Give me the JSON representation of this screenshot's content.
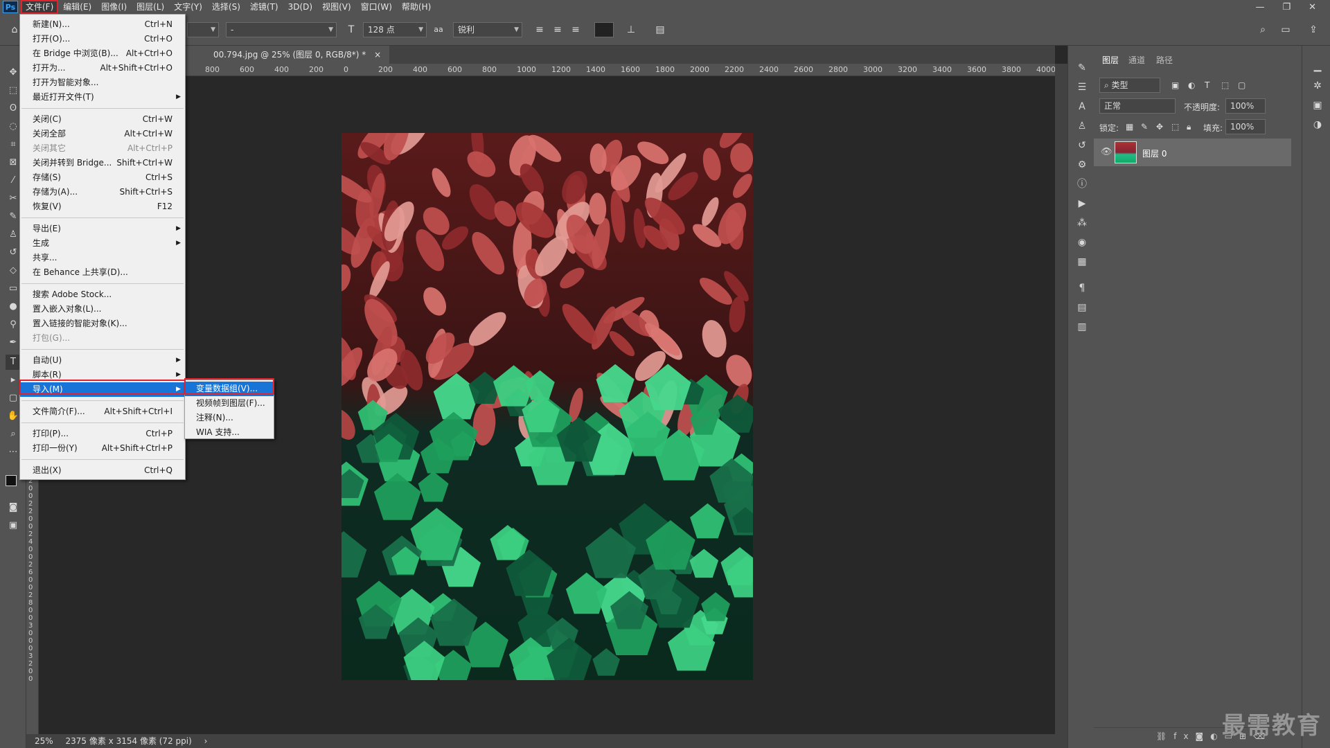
{
  "menubar": {
    "logo": "Ps",
    "items": [
      "文件(F)",
      "编辑(E)",
      "图像(I)",
      "图层(L)",
      "文字(Y)",
      "选择(S)",
      "滤镜(T)",
      "3D(D)",
      "视图(V)",
      "窗口(W)",
      "帮助(H)"
    ],
    "window_buttons": [
      "—",
      "❐",
      "✕"
    ]
  },
  "options": {
    "font_style": "-",
    "font_size": "128 点",
    "aa_icon": "aa",
    "antialias": "锐利"
  },
  "document": {
    "tab_title": "00.794.jpg @ 25% (图层 0, RGB/8*) *",
    "close": "×"
  },
  "ruler_h": [
    "800",
    "600",
    "400",
    "200",
    "0",
    "200",
    "400",
    "600",
    "800",
    "1000",
    "1200",
    "1400",
    "1600",
    "1800",
    "2000",
    "2200",
    "2400",
    "2600",
    "2800",
    "3000",
    "3200",
    "3400",
    "3600",
    "3800",
    "4000"
  ],
  "ruler_v": [
    "2",
    "0",
    "0",
    "2",
    "2",
    "0",
    "0",
    "2",
    "4",
    "0",
    "0",
    "2",
    "6",
    "0",
    "0",
    "2",
    "8",
    "0",
    "0",
    "3",
    "0",
    "0",
    "0",
    "3",
    "2",
    "0",
    "0"
  ],
  "status": {
    "zoom": "25%",
    "info": "2375 像素 x 3154 像素 (72 ppi)",
    "arrow": "›"
  },
  "file_menu": {
    "items": [
      {
        "label": "新建(N)...",
        "shortcut": "Ctrl+N"
      },
      {
        "label": "打开(O)...",
        "shortcut": "Ctrl+O"
      },
      {
        "label": "在 Bridge 中浏览(B)...",
        "shortcut": "Alt+Ctrl+O"
      },
      {
        "label": "打开为...",
        "shortcut": "Alt+Shift+Ctrl+O"
      },
      {
        "label": "打开为智能对象..."
      },
      {
        "label": "最近打开文件(T)",
        "submenu": true
      },
      {
        "sep": true
      },
      {
        "label": "关闭(C)",
        "shortcut": "Ctrl+W"
      },
      {
        "label": "关闭全部",
        "shortcut": "Alt+Ctrl+W"
      },
      {
        "label": "关闭其它",
        "shortcut": "Alt+Ctrl+P",
        "disabled": true
      },
      {
        "label": "关闭并转到 Bridge...",
        "shortcut": "Shift+Ctrl+W"
      },
      {
        "label": "存储(S)",
        "shortcut": "Ctrl+S"
      },
      {
        "label": "存储为(A)...",
        "shortcut": "Shift+Ctrl+S"
      },
      {
        "label": "恢复(V)",
        "shortcut": "F12"
      },
      {
        "sep": true
      },
      {
        "label": "导出(E)",
        "submenu": true
      },
      {
        "label": "生成",
        "submenu": true
      },
      {
        "label": "共享..."
      },
      {
        "label": "在 Behance 上共享(D)..."
      },
      {
        "sep": true
      },
      {
        "label": "搜索 Adobe Stock..."
      },
      {
        "label": "置入嵌入对象(L)..."
      },
      {
        "label": "置入链接的智能对象(K)..."
      },
      {
        "label": "打包(G)...",
        "disabled": true
      },
      {
        "sep": true
      },
      {
        "label": "自动(U)",
        "submenu": true
      },
      {
        "label": "脚本(R)",
        "submenu": true
      },
      {
        "label": "导入(M)",
        "submenu": true,
        "highlighted": true
      },
      {
        "sep": true
      },
      {
        "label": "文件简介(F)...",
        "shortcut": "Alt+Shift+Ctrl+I"
      },
      {
        "sep": true
      },
      {
        "label": "打印(P)...",
        "shortcut": "Ctrl+P"
      },
      {
        "label": "打印一份(Y)",
        "shortcut": "Alt+Shift+Ctrl+P"
      },
      {
        "sep": true
      },
      {
        "label": "退出(X)",
        "shortcut": "Ctrl+Q"
      }
    ]
  },
  "import_submenu": {
    "items": [
      {
        "label": "变量数据组(V)...",
        "highlighted": true
      },
      {
        "label": "视频帧到图层(F)..."
      },
      {
        "label": "注释(N)..."
      },
      {
        "label": "WIA 支持..."
      }
    ]
  },
  "layers_panel": {
    "tabs": [
      "图层",
      "通道",
      "路径"
    ],
    "filter_kind": "类型",
    "blend_mode": "正常",
    "opacity_label": "不透明度:",
    "opacity": "100%",
    "lock_label": "锁定:",
    "fill_label": "填充:",
    "fill": "100%",
    "layers": [
      {
        "name": "图层 0",
        "visible": true
      }
    ]
  },
  "watermark": "最需教育",
  "colors": {
    "highlight": "#1874d6",
    "annotation": "#e0232c",
    "panel": "#535353",
    "canvas": "#282828"
  }
}
